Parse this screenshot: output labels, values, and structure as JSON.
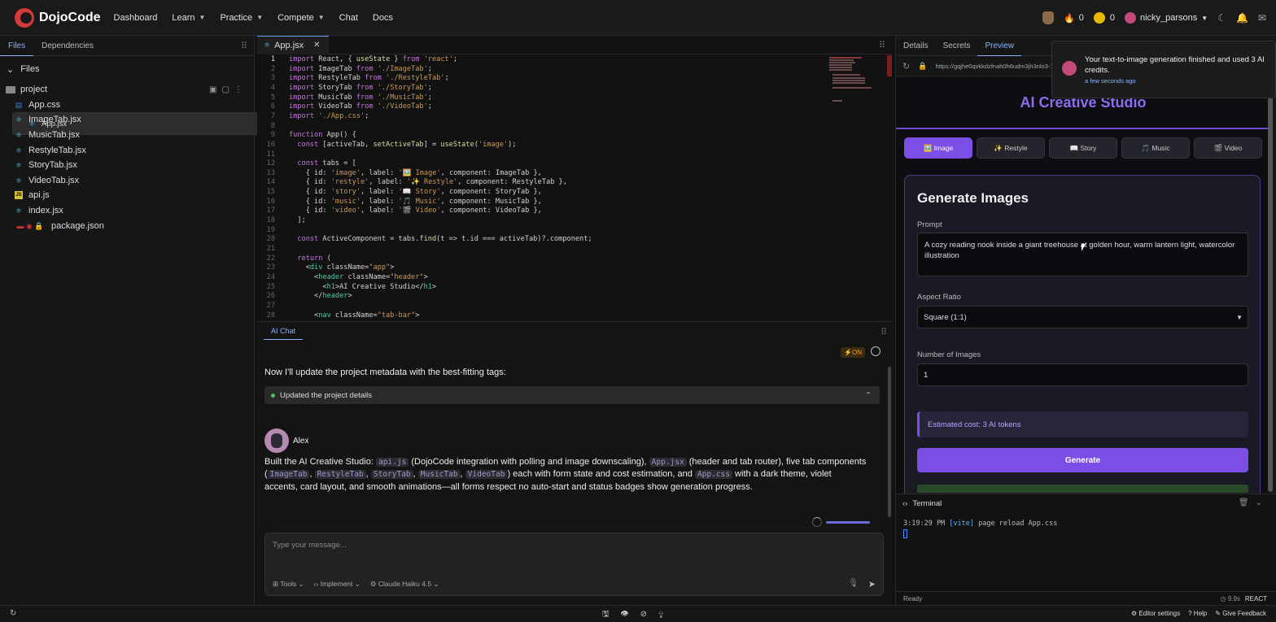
{
  "nav": {
    "brand": "DojoCode",
    "links": [
      {
        "label": "Dashboard",
        "chev": false
      },
      {
        "label": "Learn",
        "chev": true
      },
      {
        "label": "Practice",
        "chev": true
      },
      {
        "label": "Compete",
        "chev": true
      },
      {
        "label": "Chat",
        "chev": false
      },
      {
        "label": "Docs",
        "chev": false
      }
    ],
    "streak": "0",
    "coins": "0",
    "username": "nicky_parsons"
  },
  "sidebar": {
    "tabs": [
      "Files",
      "Dependencies"
    ],
    "files_header": "Files",
    "project": "project",
    "files": [
      {
        "name": "App.css",
        "type": "css"
      },
      {
        "name": "App.jsx",
        "type": "react",
        "selected": true
      },
      {
        "name": "ImageTab.jsx",
        "type": "react"
      },
      {
        "name": "MusicTab.jsx",
        "type": "react"
      },
      {
        "name": "RestyleTab.jsx",
        "type": "react"
      },
      {
        "name": "StoryTab.jsx",
        "type": "react"
      },
      {
        "name": "VideoTab.jsx",
        "type": "react"
      },
      {
        "name": "api.js",
        "type": "js"
      },
      {
        "name": "index.jsx",
        "type": "react"
      },
      {
        "name": "package.json",
        "type": "json"
      }
    ]
  },
  "editor": {
    "tab": "App.jsx",
    "lines": [
      "import React, { useState } from 'react';",
      "import ImageTab from './ImageTab';",
      "import RestyleTab from './RestyleTab';",
      "import StoryTab from './StoryTab';",
      "import MusicTab from './MusicTab';",
      "import VideoTab from './VideoTab';",
      "import './App.css';",
      "",
      "function App() {",
      "  const [activeTab, setActiveTab] = useState('image');",
      "",
      "  const tabs = [",
      "    { id: 'image', label: '🖼️ Image', component: ImageTab },",
      "    { id: 'restyle', label: '✨ Restyle', component: RestyleTab },",
      "    { id: 'story', label: '📖 Story', component: StoryTab },",
      "    { id: 'music', label: '🎵 Music', component: MusicTab },",
      "    { id: 'video', label: '🎬 Video', component: VideoTab },",
      "  ];",
      "",
      "  const ActiveComponent = tabs.find(t => t.id === activeTab)?.component;",
      "",
      "  return (",
      "    <div className=\"app\">",
      "      <header className=\"header\">",
      "        <h1>AI Creative Studio</h1>",
      "      </header>",
      "",
      "      <nav className=\"tab-bar\">"
    ]
  },
  "chat": {
    "tab": "AI Chat",
    "on_badge": "⚡ON",
    "message1": "Now I'll update the project metadata with the best-fitting tags:",
    "status": "Updated the project details",
    "author": "Alex",
    "msg2": {
      "p1": "Built the AI Creative Studio: ",
      "c1": "api.js",
      "p2": " (DojoCode integration with polling and image downscaling), ",
      "c2": "App.jsx",
      "p3": " (header and tab router), five tab components (",
      "c3": "ImageTab",
      "s1": ", ",
      "c4": "RestyleTab",
      "s2": ", ",
      "c5": "StoryTab",
      "s3": ", ",
      "c6": "MusicTab",
      "s4": ", ",
      "c7": "VideoTab",
      "p4": ") each with form state and cost estimation, and ",
      "c8": "App.css",
      "p5": " with a dark theme, violet accents, card layout, and smooth animations—all forms respect no auto-start and status badges show generation progress."
    },
    "input_placeholder": "Type your message...",
    "tools": [
      "Tools",
      "Implement",
      "Claude Haiku 4.5"
    ]
  },
  "right": {
    "tabs": [
      "Details",
      "Secrets",
      "Preview"
    ],
    "url": "https://gqjhe0qvkkdzfnah0h6udm3jh3nlo3-1",
    "app_title": "AI Creative Studio",
    "preview_tabs": [
      "🖼️ Image",
      "✨ Restyle",
      "📖 Story",
      "🎵 Music",
      "🎬 Video"
    ],
    "card_title": "Generate Images",
    "prompt_label": "Prompt",
    "prompt_value": "A cozy reading nook inside a giant treehouse at golden hour, warm lantern light, watercolor illustration",
    "aspect_label": "Aspect Ratio",
    "aspect_value": "Square (1:1)",
    "num_label": "Number of Images",
    "num_value": "1",
    "estimate": "Estimated cost: 3 AI tokens",
    "generate": "Generate",
    "terminal_title": "Terminal",
    "terminal_time": "3:19:29 PM",
    "terminal_tag": "[vite]",
    "terminal_msg": "page reload App.css",
    "status": "Ready",
    "status_time": "9.9s",
    "status_fw": "REACT"
  },
  "toast": {
    "text": "Your text-to-image generation finished and used 3 AI credits.",
    "time": "a few seconds ago"
  },
  "bottom": {
    "editor_settings": "Editor settings",
    "help": "Help",
    "feedback": "Give Feedback"
  }
}
